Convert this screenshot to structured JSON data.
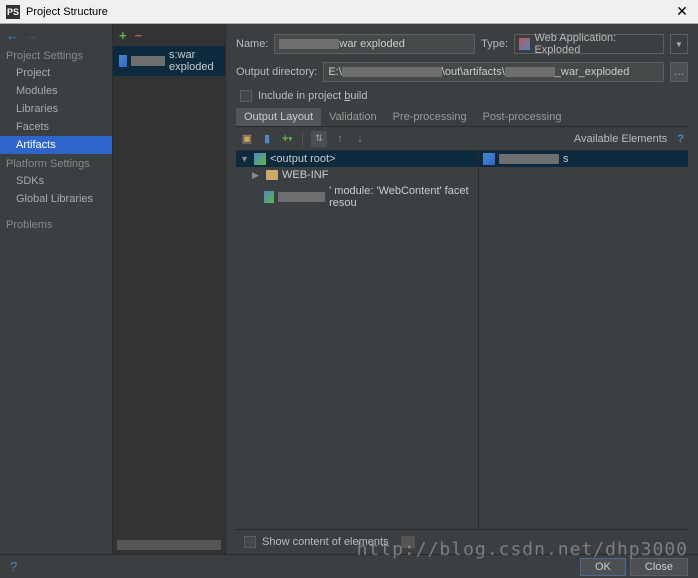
{
  "titlebar": {
    "title": "Project Structure"
  },
  "sidebar": {
    "section1": "Project Settings",
    "items1": [
      "Project",
      "Modules",
      "Libraries",
      "Facets",
      "Artifacts"
    ],
    "section2": "Platform Settings",
    "items2": [
      "SDKs",
      "Global Libraries"
    ],
    "section3": "Problems"
  },
  "middle": {
    "suffix": "s:war exploded"
  },
  "form": {
    "name_label": "Name:",
    "name_value": "war exploded",
    "type_label": "Type:",
    "type_value": "Web Application: Exploded",
    "outdir_label": "Output directory:",
    "outdir_prefix": "E:\\",
    "outdir_mid": "\\out\\artifacts\\",
    "outdir_suffix": "_war_exploded",
    "include_label": "Include in project build",
    "include_u": "b"
  },
  "tabs": [
    "Output Layout",
    "Validation",
    "Pre-processing",
    "Post-processing"
  ],
  "toolbar": {
    "available": "Available Elements",
    "help": "?"
  },
  "tree": {
    "root": "<output root>",
    "webinf": "WEB-INF",
    "module_suffix": "' module: 'WebContent' facet resou",
    "right_suffix": "s"
  },
  "bottom": {
    "show_label": "Show content of elements"
  },
  "footer": {
    "ok": "OK",
    "close": "Close"
  },
  "watermark": "http://blog.csdn.net/dhp3000"
}
